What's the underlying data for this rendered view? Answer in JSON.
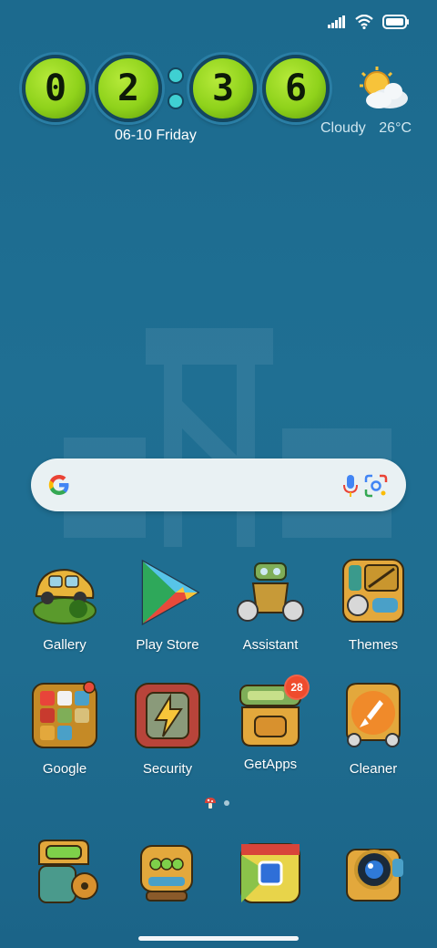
{
  "status_bar": {
    "signal_icon": "signal-icon",
    "wifi_icon": "wifi-icon",
    "battery_icon": "battery-icon"
  },
  "clock": {
    "digits": [
      "0",
      "2",
      "3",
      "6"
    ],
    "date": "06-10 Friday"
  },
  "weather": {
    "icon": "partly-cloudy-icon",
    "condition": "Cloudy",
    "temperature": "26°C"
  },
  "search": {
    "google_icon": "google-g-icon",
    "mic_icon": "mic-icon",
    "lens_icon": "lens-icon"
  },
  "apps": [
    {
      "label": "Gallery"
    },
    {
      "label": "Play Store"
    },
    {
      "label": "Assistant"
    },
    {
      "label": "Themes"
    },
    {
      "label": "Google"
    },
    {
      "label": "Security"
    },
    {
      "label": "GetApps",
      "badge": "28"
    },
    {
      "label": "Cleaner"
    }
  ],
  "dock": [
    "phone-icon",
    "messages-icon",
    "chrome-icon",
    "camera-icon"
  ],
  "colors": {
    "background": "#1f6d90",
    "clock_green": "#8fd21b",
    "badge": "#ef4b2d"
  }
}
